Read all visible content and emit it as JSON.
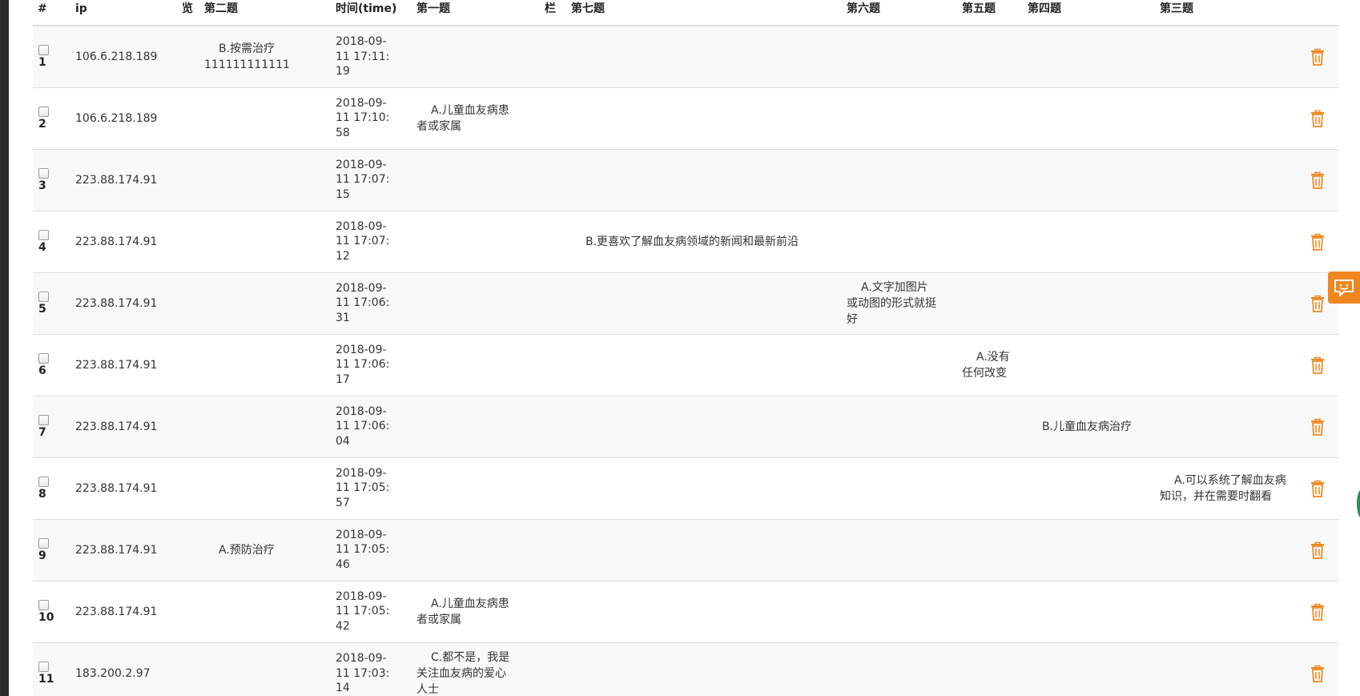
{
  "headers": {
    "num": "#",
    "ip": "ip",
    "lan": "览",
    "q2": "第二题",
    "time": "时间(time)",
    "q1": "第一题",
    "col": "栏",
    "q7": "第七题",
    "q6": "第六题",
    "q5": "第五题",
    "q4": "第四题",
    "q3": "第三题"
  },
  "rows": [
    {
      "num": "1",
      "ip": "106.6.218.189",
      "q2": "B.按需治疗　　111111111111",
      "time": "2018-09-11 17:11:19",
      "q1": "",
      "q7": "",
      "q6": "",
      "q5": "",
      "q4": "",
      "q3": ""
    },
    {
      "num": "2",
      "ip": "106.6.218.189",
      "q2": "",
      "time": "2018-09-11 17:10:58",
      "q1": "A.儿童血友病患者或家属",
      "q7": "",
      "q6": "",
      "q5": "",
      "q4": "",
      "q3": ""
    },
    {
      "num": "3",
      "ip": "223.88.174.91",
      "q2": "",
      "time": "2018-09-11 17:07:15",
      "q1": "",
      "q7": "",
      "q6": "",
      "q5": "",
      "q4": "",
      "q3": ""
    },
    {
      "num": "4",
      "ip": "223.88.174.91",
      "q2": "",
      "time": "2018-09-11 17:07:12",
      "q1": "",
      "q7": "B.更喜欢了解血友病领域的新闻和最新前沿",
      "q6": "",
      "q5": "",
      "q4": "",
      "q3": ""
    },
    {
      "num": "5",
      "ip": "223.88.174.91",
      "q2": "",
      "time": "2018-09-11 17:06:31",
      "q1": "",
      "q7": "",
      "q6": "A.文字加图片或动图的形式就挺好",
      "q5": "",
      "q4": "",
      "q3": ""
    },
    {
      "num": "6",
      "ip": "223.88.174.91",
      "q2": "",
      "time": "2018-09-11 17:06:17",
      "q1": "",
      "q7": "",
      "q6": "",
      "q5": "A.没有任何改变",
      "q4": "",
      "q3": ""
    },
    {
      "num": "7",
      "ip": "223.88.174.91",
      "q2": "",
      "time": "2018-09-11 17:06:04",
      "q1": "",
      "q7": "",
      "q6": "",
      "q5": "",
      "q4": "B.儿童血友病治疗",
      "q3": ""
    },
    {
      "num": "8",
      "ip": "223.88.174.91",
      "q2": "",
      "time": "2018-09-11 17:05:57",
      "q1": "",
      "q7": "",
      "q6": "",
      "q5": "",
      "q4": "",
      "q3": "A.可以系统了解血友病知识，并在需要时翻看"
    },
    {
      "num": "9",
      "ip": "223.88.174.91",
      "q2": "A.预防治疗",
      "time": "2018-09-11 17:05:46",
      "q1": "",
      "q7": "",
      "q6": "",
      "q5": "",
      "q4": "",
      "q3": ""
    },
    {
      "num": "10",
      "ip": "223.88.174.91",
      "q2": "",
      "time": "2018-09-11 17:05:42",
      "q1": "A.儿童血友病患者或家属",
      "q7": "",
      "q6": "",
      "q5": "",
      "q4": "",
      "q3": ""
    },
    {
      "num": "11",
      "ip": "183.200.2.97",
      "q2": "",
      "time": "2018-09-11 17:03:14",
      "q1": "C.都不是，我是关注血友病的爱心人士",
      "q7": "",
      "q6": "",
      "q5": "",
      "q4": "",
      "q3": ""
    }
  ],
  "colors": {
    "accent": "#f0861e",
    "header_border": "#dddddd",
    "row_alt": "#f9f9f9"
  },
  "icons": {
    "delete": "trash-icon",
    "feedback": "feedback-chat-icon",
    "checkbox": "row-checkbox"
  }
}
